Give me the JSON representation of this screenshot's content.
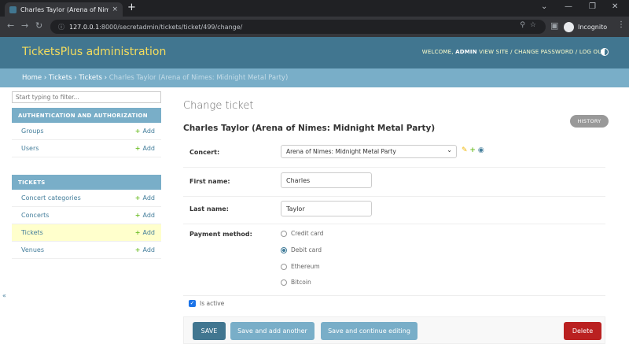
{
  "browser": {
    "tab_title": "Charles Taylor (Arena of Nimes: M",
    "tab_close": "×",
    "new_tab": "+",
    "url_host": "127.0.0.1",
    "url_path": ":8000/secretadmin/tickets/ticket/499/change/",
    "profile": "Incognito"
  },
  "admin": {
    "site_name": "TicketsPlus administration",
    "welcome": "WELCOME,",
    "user": "ADMIN",
    "links": "VIEW SITE / CHANGE PASSWORD / LOG OUT"
  },
  "breadcrumbs": {
    "home": "Home",
    "app": "Tickets",
    "model": "Tickets",
    "current": "Charles Taylor (Arena of Nimes: Midnight Metal Party)",
    "sep": "›"
  },
  "sidebar": {
    "filter_placeholder": "Start typing to filter...",
    "collapse": "«",
    "modules": [
      {
        "caption": "AUTHENTICATION AND AUTHORIZATION",
        "items": [
          {
            "label": "Groups",
            "add": "Add"
          },
          {
            "label": "Users",
            "add": "Add"
          }
        ]
      },
      {
        "caption": "TICKETS",
        "items": [
          {
            "label": "Concert categories",
            "add": "Add"
          },
          {
            "label": "Concerts",
            "add": "Add"
          },
          {
            "label": "Tickets",
            "add": "Add",
            "selected": true
          },
          {
            "label": "Venues",
            "add": "Add"
          }
        ]
      }
    ]
  },
  "content": {
    "page_title": "Change ticket",
    "object_title": "Charles Taylor (Arena of Nimes: Midnight Metal Party)",
    "history": "HISTORY",
    "concert_label": "Concert:",
    "concert_value": "Arena of Nimes: Midnight Metal Party",
    "first_name_label": "First name:",
    "first_name": "Charles",
    "last_name_label": "Last name:",
    "last_name": "Taylor",
    "payment_label": "Payment method:",
    "payment_options": [
      "Credit card",
      "Debit card",
      "Ethereum",
      "Bitcoin"
    ],
    "payment_selected": "Debit card",
    "is_active_label": "Is active",
    "is_active": true,
    "buttons": {
      "save": "SAVE",
      "save_add": "Save and add another",
      "save_continue": "Save and continue editing",
      "delete": "Delete"
    }
  }
}
